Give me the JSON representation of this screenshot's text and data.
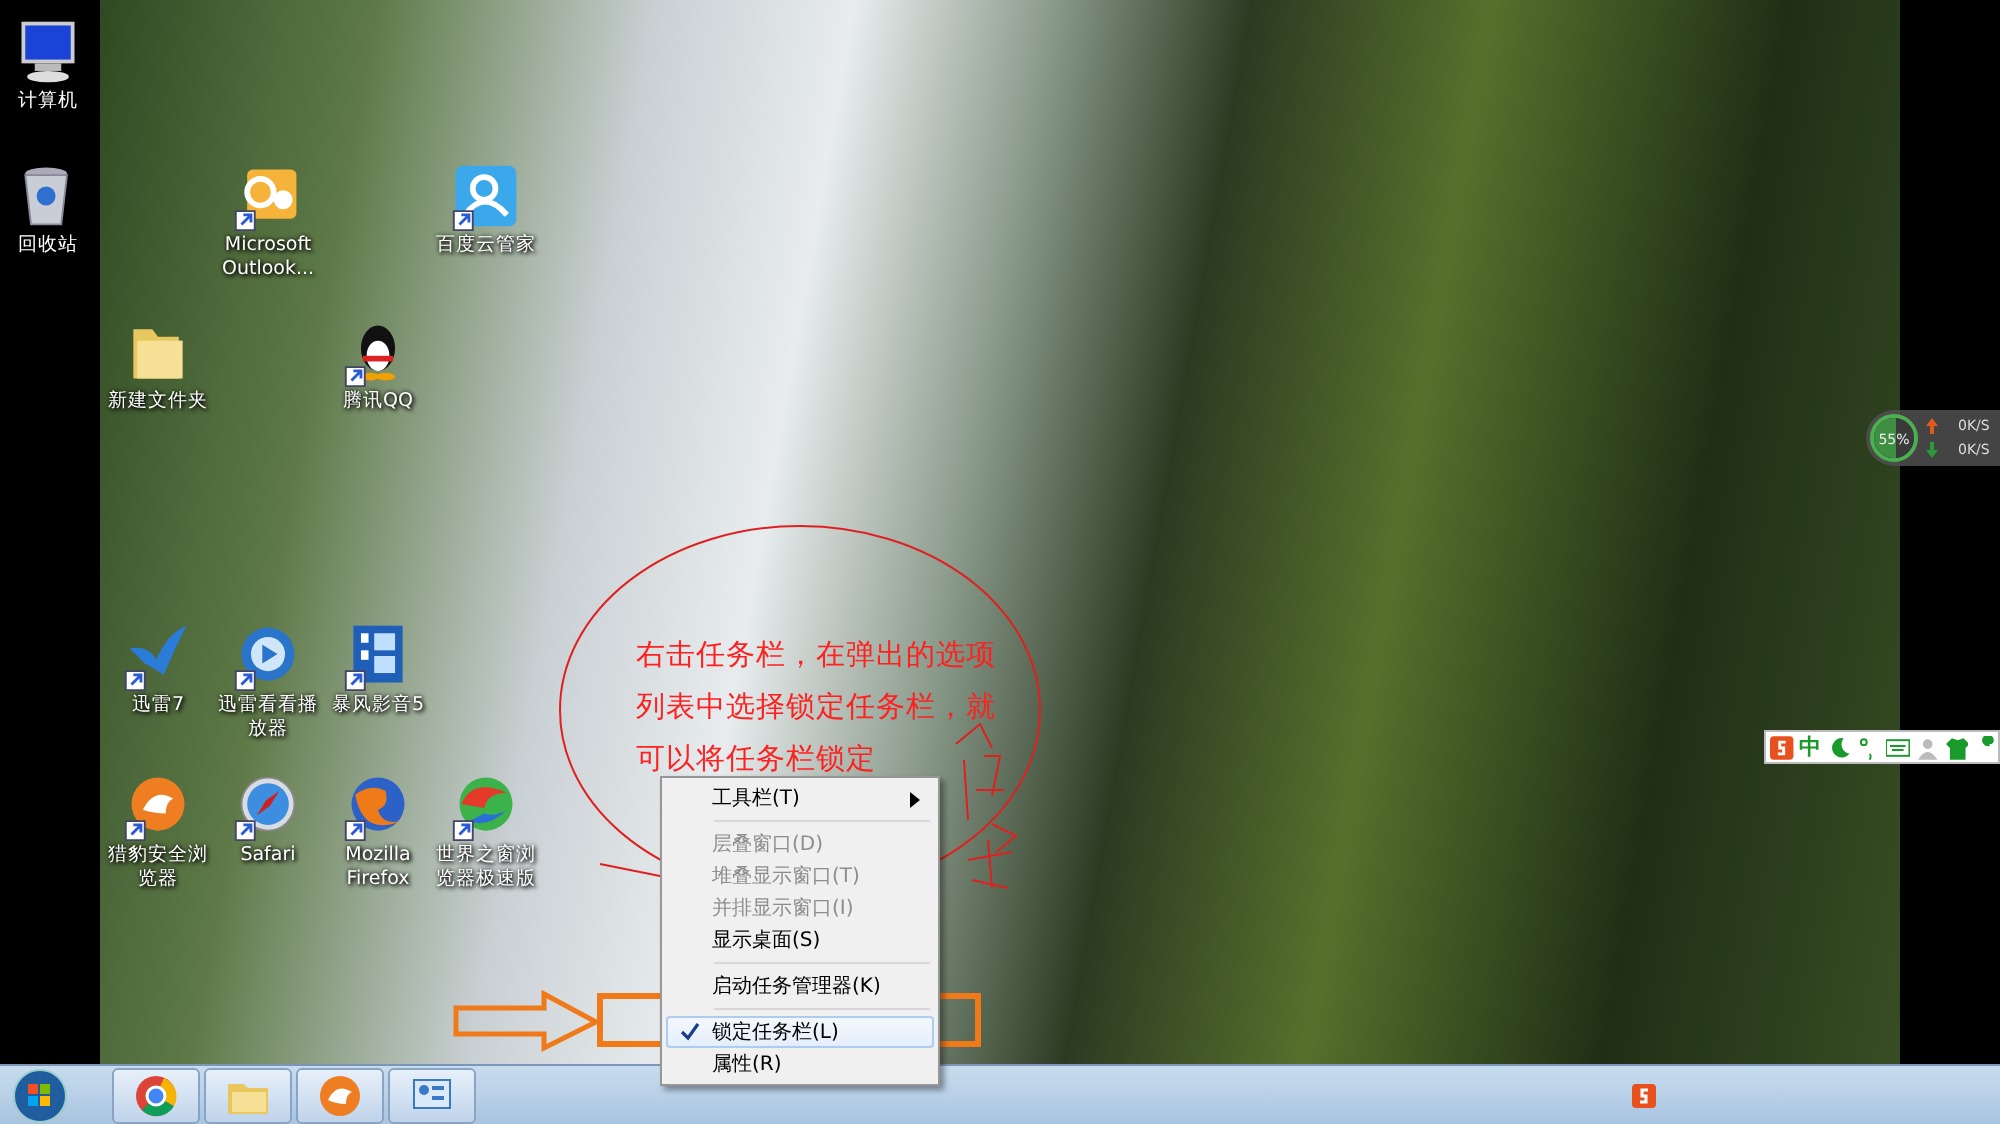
{
  "desktop_icons": [
    {
      "label": "计算机"
    },
    {
      "label": "回收站"
    },
    {
      "label": "Microsoft Outlook..."
    },
    {
      "label": "百度云管家"
    },
    {
      "label": "新建文件夹"
    },
    {
      "label": "腾讯QQ"
    },
    {
      "label": "迅雷7"
    },
    {
      "label": "迅雷看看播放器"
    },
    {
      "label": "暴风影音5"
    },
    {
      "label": "猎豹安全浏览器"
    },
    {
      "label": "Safari"
    },
    {
      "label": "Mozilla Firefox"
    },
    {
      "label": "世界之窗浏览器极速版"
    }
  ],
  "annotation": {
    "text": "右击任务栏，在弹出的选项列表中选择锁定任务栏，就可以将任务栏锁定"
  },
  "context_menu": {
    "items": [
      {
        "kind": "submenu",
        "label": "工具栏(T)",
        "disabled": false,
        "checked": false,
        "highlighted": false
      },
      {
        "kind": "separator"
      },
      {
        "kind": "item",
        "label": "层叠窗口(D)",
        "disabled": true,
        "checked": false,
        "highlighted": false
      },
      {
        "kind": "item",
        "label": "堆叠显示窗口(T)",
        "disabled": true,
        "checked": false,
        "highlighted": false
      },
      {
        "kind": "item",
        "label": "并排显示窗口(I)",
        "disabled": true,
        "checked": false,
        "highlighted": false
      },
      {
        "kind": "item",
        "label": "显示桌面(S)",
        "disabled": false,
        "checked": false,
        "highlighted": false
      },
      {
        "kind": "separator"
      },
      {
        "kind": "item",
        "label": "启动任务管理器(K)",
        "disabled": false,
        "checked": false,
        "highlighted": false
      },
      {
        "kind": "separator"
      },
      {
        "kind": "item",
        "label": "锁定任务栏(L)",
        "disabled": false,
        "checked": true,
        "highlighted": true
      },
      {
        "kind": "item",
        "label": "属性(R)",
        "disabled": false,
        "checked": false,
        "highlighted": false
      }
    ]
  },
  "speed_widget": {
    "level": 0.55,
    "reading": "55%",
    "upload": "0K/S",
    "download": "0K/S"
  },
  "ime_bar": {
    "mode": "中"
  }
}
